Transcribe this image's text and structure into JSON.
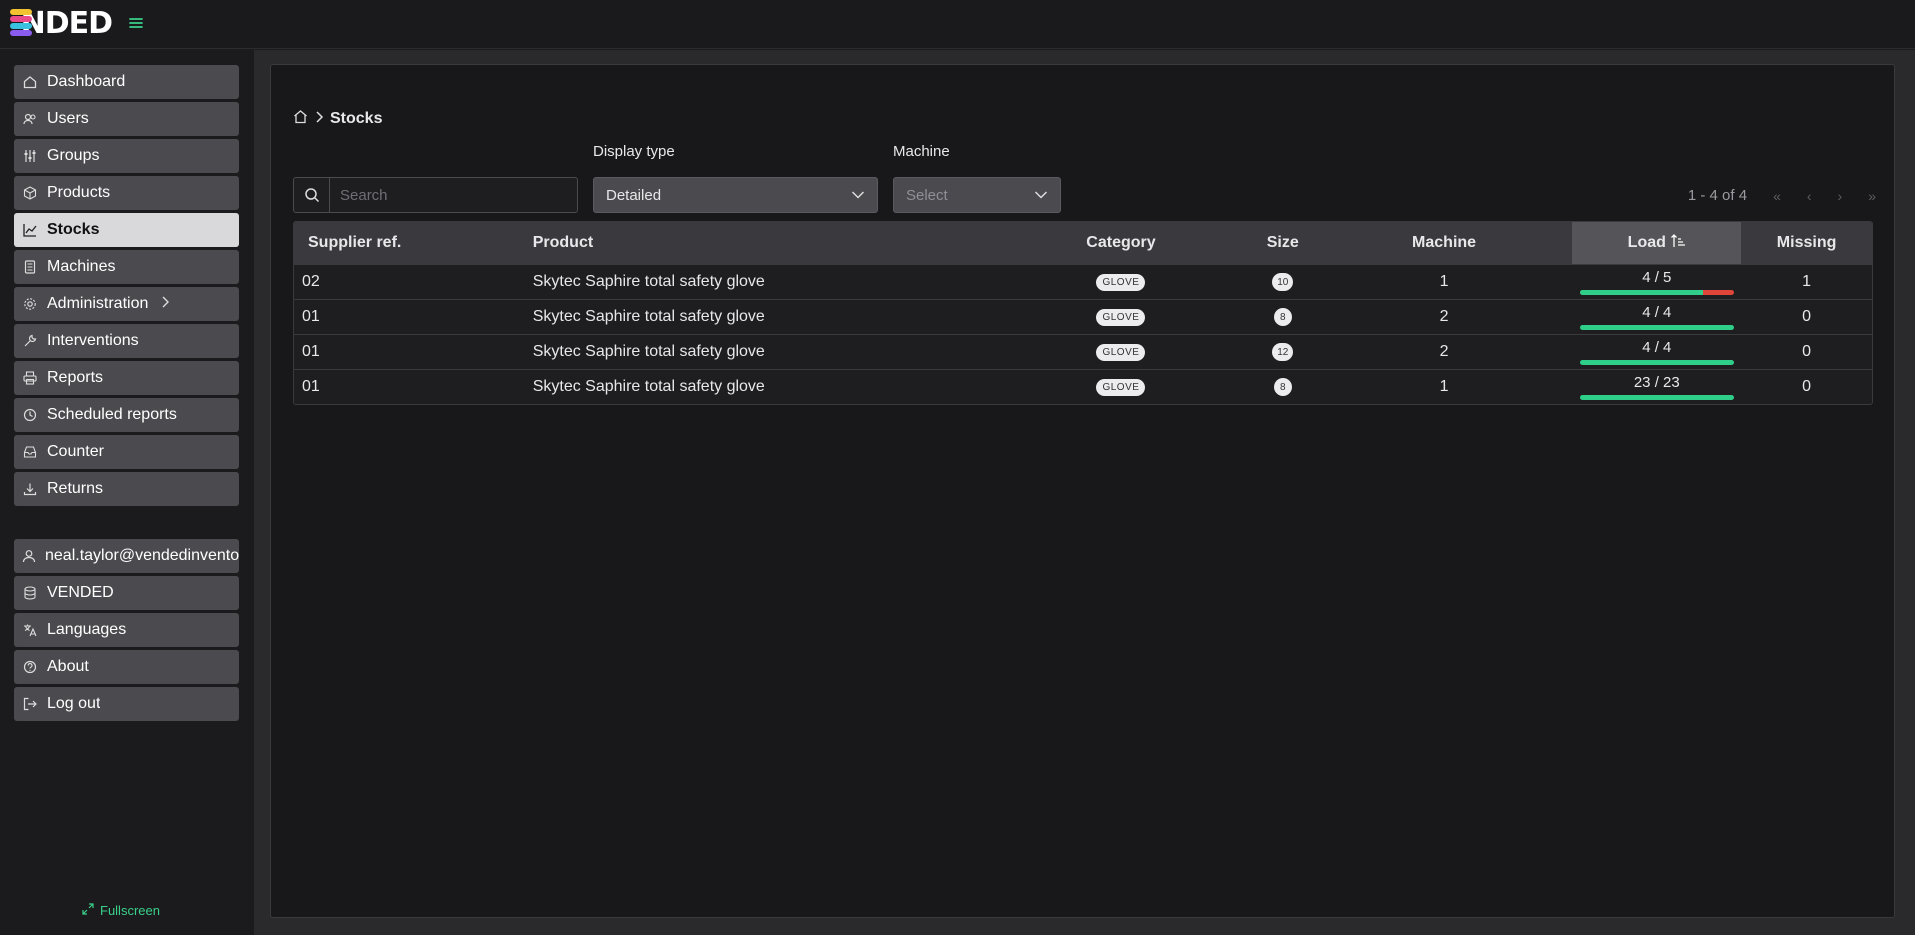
{
  "header": {
    "logo_text": "NDED",
    "menu_icon": "hamburger-icon"
  },
  "sidebar": {
    "items": [
      {
        "label": "Dashboard",
        "icon": "home-icon"
      },
      {
        "label": "Users",
        "icon": "users-icon"
      },
      {
        "label": "Groups",
        "icon": "sliders-icon"
      },
      {
        "label": "Products",
        "icon": "box-icon"
      },
      {
        "label": "Stocks",
        "icon": "chart-icon",
        "active": true
      },
      {
        "label": "Machines",
        "icon": "machine-icon"
      },
      {
        "label": "Administration",
        "icon": "gear-icon"
      },
      {
        "label": "Interventions",
        "icon": "wrench-icon"
      },
      {
        "label": "Reports",
        "icon": "printer-icon"
      },
      {
        "label": "Scheduled reports",
        "icon": "clock-icon"
      },
      {
        "label": "Counter",
        "icon": "inbox-icon"
      },
      {
        "label": "Returns",
        "icon": "download-icon"
      }
    ],
    "bottom_items": [
      {
        "label": "neal.taylor@vendedinventory.com",
        "icon": "user-icon"
      },
      {
        "label": "VENDED",
        "icon": "database-icon"
      },
      {
        "label": "Languages",
        "icon": "translate-icon"
      },
      {
        "label": "About",
        "icon": "help-icon"
      },
      {
        "label": "Log out",
        "icon": "logout-icon"
      }
    ],
    "fullscreen_label": "Fullscreen"
  },
  "main": {
    "breadcrumb": {
      "current": "Stocks"
    },
    "search": {
      "placeholder": "Search",
      "value": ""
    },
    "display_type": {
      "label": "Display type",
      "value": "Detailed"
    },
    "machine": {
      "label": "Machine",
      "placeholder": "Select"
    },
    "pagination": {
      "range": "1 - 4 of 4"
    },
    "table": {
      "columns": [
        "Supplier ref.",
        "Product",
        "Category",
        "Size",
        "Machine",
        "Load",
        "Missing"
      ],
      "rows": [
        {
          "supplier_ref": "02",
          "product": "Skytec Saphire total safety glove",
          "category": "GLOVE",
          "size": "10",
          "machine": "1",
          "load": "4 / 5",
          "load_fraction": 0.8,
          "missing": "1"
        },
        {
          "supplier_ref": "01",
          "product": "Skytec Saphire total safety glove",
          "category": "GLOVE",
          "size": "8",
          "machine": "2",
          "load": "4 / 4",
          "load_fraction": 1.0,
          "missing": "0"
        },
        {
          "supplier_ref": "01",
          "product": "Skytec Saphire total safety glove",
          "category": "GLOVE",
          "size": "12",
          "machine": "2",
          "load": "4 / 4",
          "load_fraction": 1.0,
          "missing": "0"
        },
        {
          "supplier_ref": "01",
          "product": "Skytec Saphire total safety glove",
          "category": "GLOVE",
          "size": "8",
          "machine": "1",
          "load": "23 / 23",
          "load_fraction": 1.0,
          "missing": "0"
        }
      ]
    }
  },
  "colors": {
    "accent": "#3ad08a",
    "danger": "#e0453a"
  }
}
